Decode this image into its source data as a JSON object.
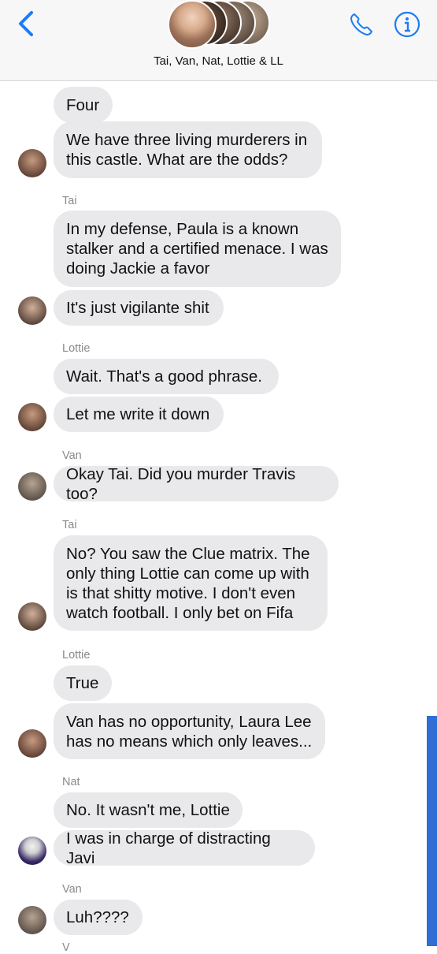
{
  "header": {
    "title": "Tai, Van, Nat, Lottie & LL",
    "back_icon": "chevron-left-icon",
    "call_icon": "phone-icon",
    "info_icon": "info-icon",
    "accent_color": "#1a7cf6"
  },
  "messages": [
    {
      "sender": "",
      "text": "Four"
    },
    {
      "sender": "",
      "text": "We have three living murderers in\nthis castle. What are the odds?"
    },
    {
      "sender": "Tai",
      "text": "In my defense, Paula is a known\nstalker and a certified menace. I was\ndoing Jackie a favor"
    },
    {
      "sender": "",
      "text": "It's just vigilante shit"
    },
    {
      "sender": "Lottie",
      "text": "Wait. That's a good phrase."
    },
    {
      "sender": "",
      "text": "Let me write it down"
    },
    {
      "sender": "Van",
      "text": "Okay Tai. Did you murder Travis too?"
    },
    {
      "sender": "Tai",
      "text": "No? You saw the Clue matrix. The\nonly thing Lottie can come up with\nis that shitty motive. I don't even\nwatch football. I only bet on Fifa"
    },
    {
      "sender": "Lottie",
      "text": "True"
    },
    {
      "sender": "",
      "text": "Van has no opportunity, Laura Lee\nhas no means which only leaves..."
    },
    {
      "sender": "Nat",
      "text": "No. It wasn't me, Lottie"
    },
    {
      "sender": "",
      "text": "I was in charge of distracting Javi"
    },
    {
      "sender": "Van",
      "text": "Luh????"
    },
    {
      "sender": "V",
      "text": ""
    }
  ],
  "colors": {
    "bubble": "#e9e9eb",
    "sender_label": "#8a8a8e",
    "scrollbar": "#2e6ed6"
  }
}
